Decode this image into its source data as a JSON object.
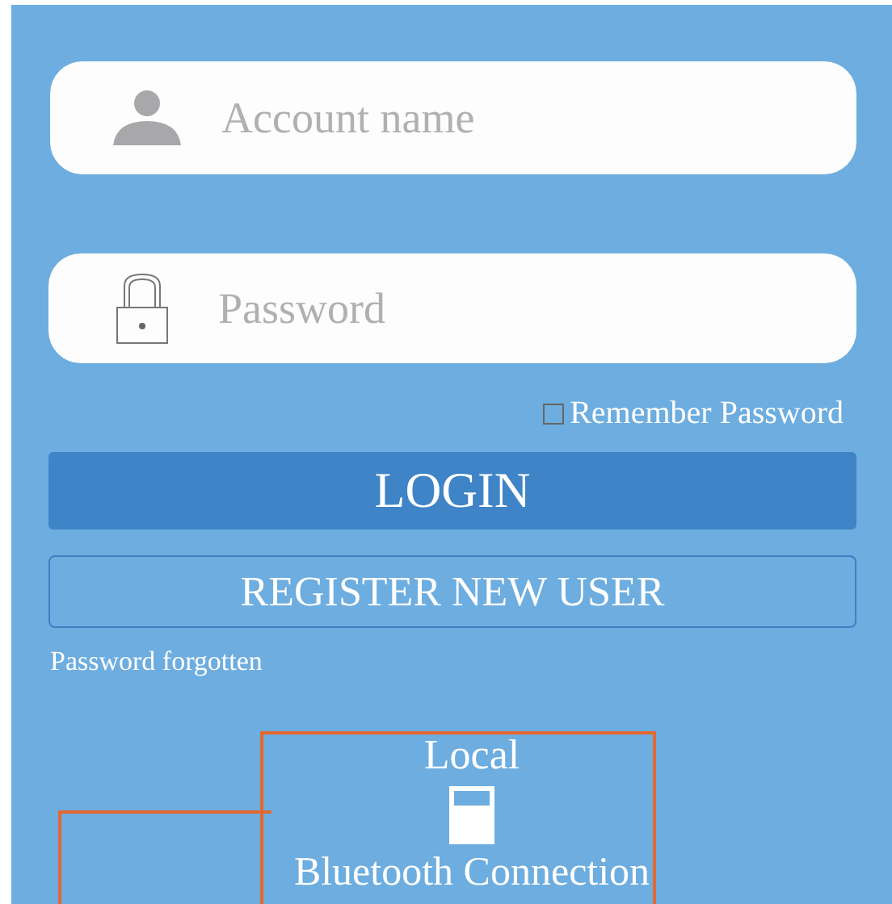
{
  "account_field": {
    "placeholder": "Account name"
  },
  "password_field": {
    "placeholder": "Password"
  },
  "remember_password": {
    "label": "Remember Password",
    "checked": false
  },
  "login_button": "LOGIN",
  "register_button": "REGISTER NEW USER",
  "forgot_link": "Password forgotten",
  "connection": {
    "title": "Local",
    "label": "Bluetooth Connection"
  }
}
